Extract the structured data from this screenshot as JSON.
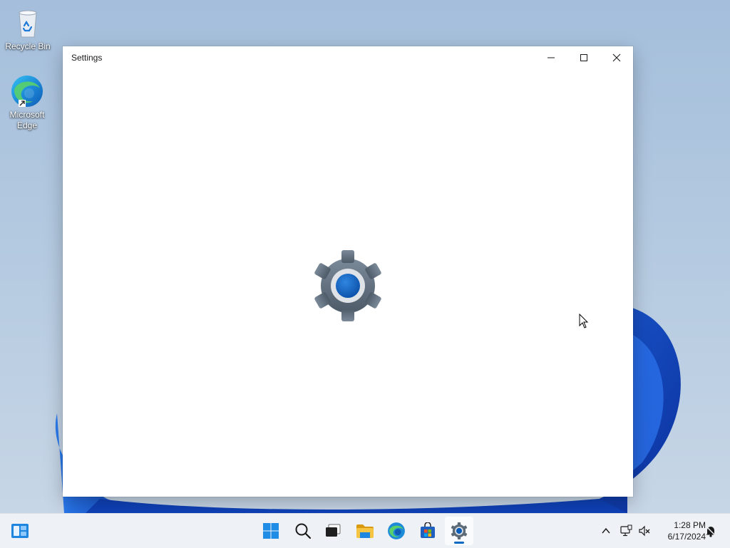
{
  "desktop": {
    "icons": [
      {
        "label": "Recycle Bin",
        "icon": "recycle-bin-icon"
      },
      {
        "label": "Microsoft\nEdge",
        "icon": "edge-icon"
      }
    ]
  },
  "window": {
    "title": "Settings",
    "splash_icon": "settings-gear-icon",
    "controls": {
      "minimize": "minimize-icon",
      "maximize": "maximize-icon",
      "close": "close-icon"
    }
  },
  "taskbar": {
    "widgets": "widgets-icon",
    "items": [
      {
        "name": "start",
        "icon": "windows-logo-icon"
      },
      {
        "name": "search",
        "icon": "search-icon"
      },
      {
        "name": "task-view",
        "icon": "task-view-icon"
      },
      {
        "name": "file-explorer",
        "icon": "folder-icon"
      },
      {
        "name": "edge",
        "icon": "edge-icon"
      },
      {
        "name": "store",
        "icon": "store-icon"
      },
      {
        "name": "settings",
        "icon": "settings-gear-icon",
        "active": true
      }
    ],
    "tray": {
      "overflow": "chevron-up-icon",
      "network": "network-icon",
      "volume": "volume-muted-icon",
      "notifications": "notification-bell-icon"
    },
    "clock": {
      "time": "1:28 PM",
      "date": "6/17/2024"
    }
  },
  "colors": {
    "accent": "#0067c0",
    "window_bg": "#ffffff",
    "taskbar_bg": "#eef2f6"
  }
}
